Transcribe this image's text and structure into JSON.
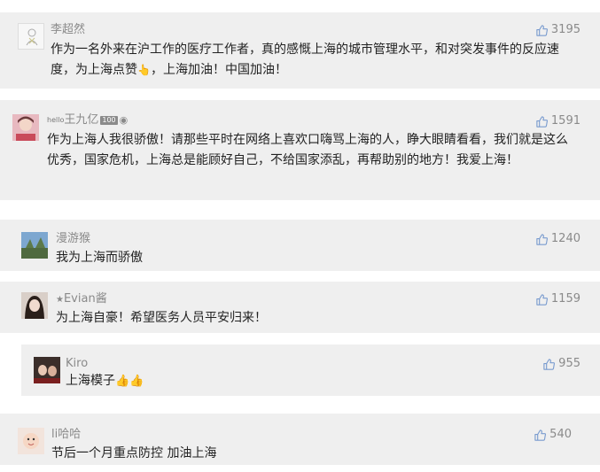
{
  "comments": [
    {
      "username": "李超然",
      "likes": "3195",
      "text": "作为一名外来在沪工作的医疗工作者，真的感慨上海的城市管理水平，和对突发事件的反应速度，为上海点赞",
      "text_suffix": "，上海加油！中国加油！",
      "emoji": "👆"
    },
    {
      "username_prefix": "hello",
      "username": "王九亿",
      "username_badge": "100",
      "likes": "1591",
      "text": "作为上海人我很骄傲！请那些平时在网络上喜欢口嗨骂上海的人，睁大眼睛看看，我们就是这么优秀，国家危机，上海总是能顾好自己，不给国家添乱，再帮助别的地方！我爱上海！"
    },
    {
      "username": "漫游猴",
      "likes": "1240",
      "text": "我为上海而骄傲"
    },
    {
      "username": "Evian酱",
      "likes": "1159",
      "text": "为上海自豪！希望医务人员平安归来！"
    },
    {
      "username": "Kiro",
      "likes": "955",
      "text": "上海模子",
      "emoji": "👍👍"
    },
    {
      "username": "li哈哈",
      "likes": "540",
      "text": "节后一个月重点防控 加油上海"
    }
  ],
  "colors": {
    "card_bg": "#efefef",
    "meta_text": "#8a8a8a",
    "body_text": "#222222"
  },
  "icons": {
    "like": "thumbs-up-outline-icon"
  }
}
